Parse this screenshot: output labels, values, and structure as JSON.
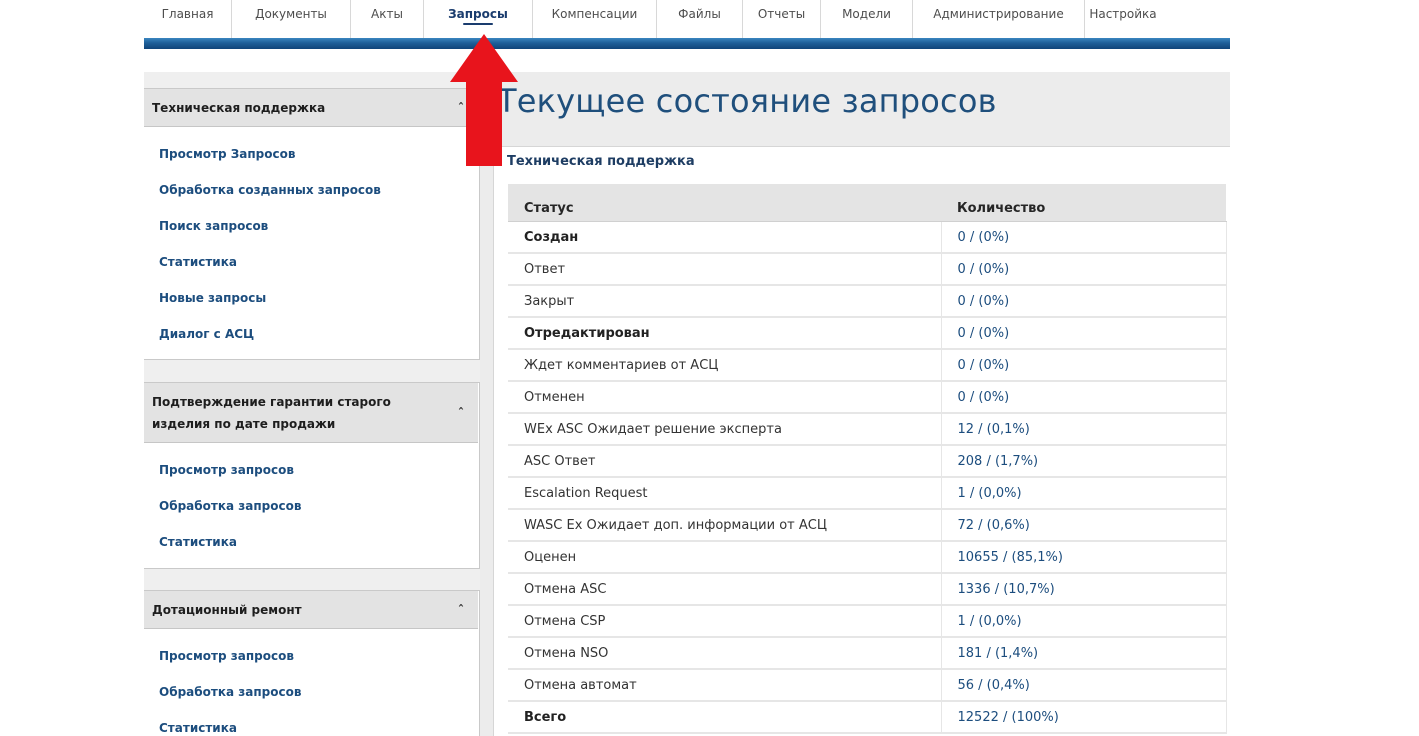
{
  "nav": {
    "items": [
      {
        "label": "Главная",
        "w": 88
      },
      {
        "label": "Документы",
        "w": 119
      },
      {
        "label": "Акты",
        "w": 73
      },
      {
        "label": "Запросы",
        "w": 109,
        "active": true
      },
      {
        "label": "Компенсации",
        "w": 124
      },
      {
        "label": "Файлы",
        "w": 86
      },
      {
        "label": "Отчеты",
        "w": 78
      },
      {
        "label": "Модели",
        "w": 92
      },
      {
        "label": "Администрирование",
        "w": 172
      },
      {
        "label": "Настройка",
        "w": 76
      }
    ]
  },
  "sidebar": {
    "panels": [
      {
        "title": "Техническая поддержка",
        "toggle": "ˆ",
        "links": [
          "Просмотр Запросов",
          "Обработка созданных запросов",
          "Поиск запросов",
          "Статистика",
          "Новые запросы",
          "Диалог с АСЦ"
        ]
      },
      {
        "title": "Подтверждение гарантии старого изделия по дате продажи",
        "toggle": "ˆ",
        "links": [
          "Просмотр запросов",
          "Обработка запросов",
          "Статистика"
        ]
      },
      {
        "title": "Дотационный ремонт",
        "toggle": "ˆ",
        "links": [
          "Просмотр запросов",
          "Обработка запросов",
          "Статистика"
        ]
      }
    ]
  },
  "main": {
    "page_title": "Текущее состояние запросов",
    "card_title": "Техническая поддержка",
    "table": {
      "headers": [
        "Статус",
        "Количество"
      ],
      "rows": [
        {
          "status": "Создан",
          "count": "0 / (0%)",
          "bold": true
        },
        {
          "status": "Ответ",
          "count": "0 / (0%)"
        },
        {
          "status": "Закрыт",
          "count": "0 / (0%)"
        },
        {
          "status": "Отредактирован",
          "count": "0 / (0%)",
          "bold": true
        },
        {
          "status": "Ждет комментариев от АСЦ",
          "count": "0 / (0%)"
        },
        {
          "status": "Отменен",
          "count": "0 / (0%)"
        },
        {
          "status": "WEx ASC Ожидает решение эксперта",
          "count": "12 / (0,1%)"
        },
        {
          "status": "ASC Ответ",
          "count": "208 / (1,7%)"
        },
        {
          "status": "Escalation Request",
          "count": "1 / (0,0%)"
        },
        {
          "status": "WASC Ex Ожидает доп. информации от АСЦ",
          "count": "72 / (0,6%)"
        },
        {
          "status": "Оценен",
          "count": "10655 / (85,1%)"
        },
        {
          "status": "Отмена ASC",
          "count": "1336 / (10,7%)"
        },
        {
          "status": "Отмена CSP",
          "count": "1 / (0,0%)"
        },
        {
          "status": "Отмена NSO",
          "count": "181 / (1,4%)"
        },
        {
          "status": "Отмена автомат",
          "count": "56 / (0,4%)"
        },
        {
          "status": "Всего",
          "count": "12522 / (100%)",
          "bold": true,
          "total": true
        }
      ]
    }
  },
  "colors": {
    "accent": "#1f4f7c",
    "link": "#1c4d7e",
    "arrow": "#e8141c",
    "bar": "#1e5f99"
  }
}
